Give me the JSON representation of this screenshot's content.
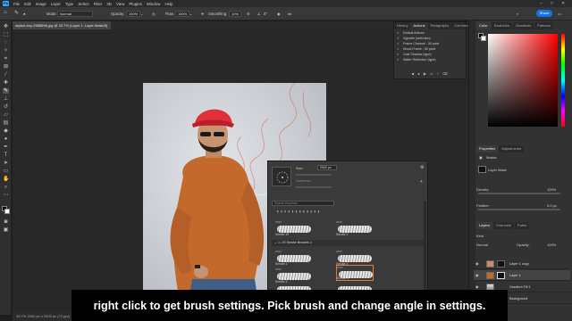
{
  "menu": {
    "app_logo": "Ps",
    "items": [
      "File",
      "Edit",
      "Image",
      "Layer",
      "Type",
      "Select",
      "Filter",
      "3D",
      "View",
      "Plugins",
      "Window",
      "Help"
    ]
  },
  "options_bar": {
    "mode_label": "Mode:",
    "mode_value": "Normal",
    "opacity_label": "Opacity:",
    "opacity_value": "100%",
    "flow_label": "Flow:",
    "flow_value": "100%",
    "smoothing_label": "Smoothing:",
    "smoothing_value": "10%",
    "angle_value": "0°",
    "share_label": "Share"
  },
  "document": {
    "tab_title": "stylish-boy-2988696.jpg @ 33.7% (Layer 1, Layer Mask/8)",
    "status": "33.7%  2000 px x 2000 px (72 ppi)"
  },
  "actions_panel": {
    "tabs": [
      "History",
      "Actions",
      "Paragraphs",
      "Comments"
    ],
    "rows": [
      "Default Actions",
      "Vignette (selection)",
      "Frame Channel - 50 pixel",
      "Wood Frame - 50 pixel",
      "Cast Shadow (type)",
      "Water Reflection (type)"
    ]
  },
  "color_panel": {
    "tabs": [
      "Color",
      "Swatches",
      "Gradients",
      "Patterns"
    ],
    "accent": "#ff0000"
  },
  "properties_panel": {
    "tabs": [
      "Properties",
      "Adjustments"
    ],
    "masks_label": "Masks",
    "layer_mask_label": "Layer Mask",
    "density_label": "Density:",
    "density_value": "100%",
    "feather_label": "Feather:",
    "feather_value": "0.0 px"
  },
  "layers_panel": {
    "tabs": [
      "Layers",
      "Channels",
      "Paths"
    ],
    "kind_label": "Kind",
    "blend_mode": "Normal",
    "opacity_label": "Opacity:",
    "opacity_value": "100%",
    "layers": [
      {
        "name": "Layer 1 copy"
      },
      {
        "name": "Layer 1"
      },
      {
        "name": "Gradient Fill 1"
      },
      {
        "name": "Background"
      }
    ]
  },
  "brush_popup": {
    "size_label": "Size:",
    "size_value": "2500 px",
    "hardness_label": "Hardness:",
    "search_placeholder": "Search Brushes",
    "folder_label": "JS Smoke Brushes 1",
    "brushes": [
      {
        "size": "2500",
        "name": "Smoke 19"
      },
      {
        "size": "2500",
        "name": "Smoke 2"
      },
      {
        "size": "2500",
        "name": "Smoke 1"
      },
      {
        "size": "2500",
        "name": "Smoke 2"
      },
      {
        "size": "2500",
        "name": "Smoke 3"
      },
      {
        "size": "2500",
        "name": "Smoke 4"
      },
      {
        "size": "2500",
        "name": "Smoke 5"
      },
      {
        "size": "2500",
        "name": "Smoke 6"
      }
    ]
  },
  "caption": "right click to get brush settings. Pick brush and change angle in settings."
}
